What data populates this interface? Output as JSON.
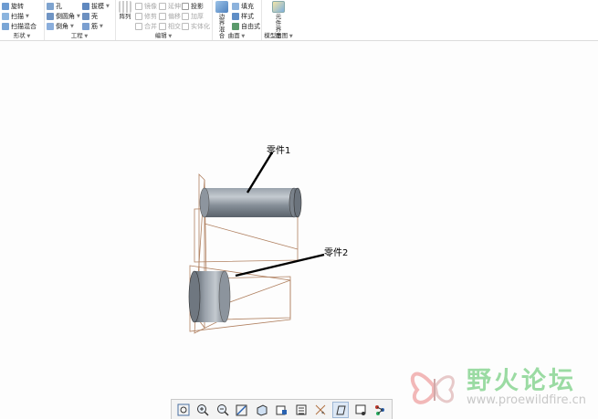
{
  "ribbon": {
    "shape_group": {
      "label": "形状",
      "items": [
        {
          "label": "旋转",
          "icon": "revolve-icon"
        },
        {
          "label": "扫描",
          "icon": "sweep-icon"
        },
        {
          "label": "扫描混合",
          "icon": "swept-blend-icon"
        }
      ]
    },
    "engineering_group": {
      "label": "工程",
      "col1": [
        {
          "label": "孔",
          "icon": "hole-icon"
        },
        {
          "label": "倒圆角",
          "icon": "round-icon"
        },
        {
          "label": "倒角",
          "icon": "chamfer-icon"
        }
      ],
      "col2": [
        {
          "label": "拔模",
          "icon": "draft-icon"
        },
        {
          "label": "壳",
          "icon": "shell-icon"
        },
        {
          "label": "筋",
          "icon": "rib-icon"
        }
      ]
    },
    "editing_group": {
      "label": "编辑",
      "pattern_label": "阵列",
      "col1": [
        {
          "label": "镜像",
          "icon": "mirror-icon"
        },
        {
          "label": "修剪",
          "icon": "trim-icon"
        },
        {
          "label": "合并",
          "icon": "merge-icon"
        }
      ],
      "col2": [
        {
          "label": "延伸",
          "icon": "extend-icon"
        },
        {
          "label": "偏移",
          "icon": "offset-icon"
        },
        {
          "label": "相交",
          "icon": "intersect-icon"
        }
      ],
      "col3": [
        {
          "label": "投影",
          "icon": "project-icon"
        },
        {
          "label": "加厚",
          "icon": "thicken-icon"
        },
        {
          "label": "实体化",
          "icon": "solidify-icon"
        }
      ]
    },
    "surface_group": {
      "label": "曲面",
      "boundary_label": "边界混合",
      "items": [
        {
          "label": "填充",
          "icon": "fill-icon"
        },
        {
          "label": "样式",
          "icon": "style-icon"
        },
        {
          "label": "自由式",
          "icon": "freestyle-icon"
        }
      ]
    },
    "model_intent_group": {
      "label": "模型意图",
      "button_label": "元件界面"
    }
  },
  "canvas": {
    "callout_part1": "零件1",
    "callout_part2": "零件2"
  },
  "view_toolbar": {
    "buttons": [
      "zoom-fit-icon",
      "zoom-in-icon",
      "zoom-out-icon",
      "repaint-icon",
      "saved-orientations-icon",
      "display-style-icon",
      "named-views-icon",
      "datum-display-icon",
      "spin-center-icon",
      "sketch-view-icon",
      "section-icon",
      "annotation-icon"
    ]
  },
  "watermark": {
    "title": "野火论坛",
    "url": "www.proewildfire.cn"
  }
}
